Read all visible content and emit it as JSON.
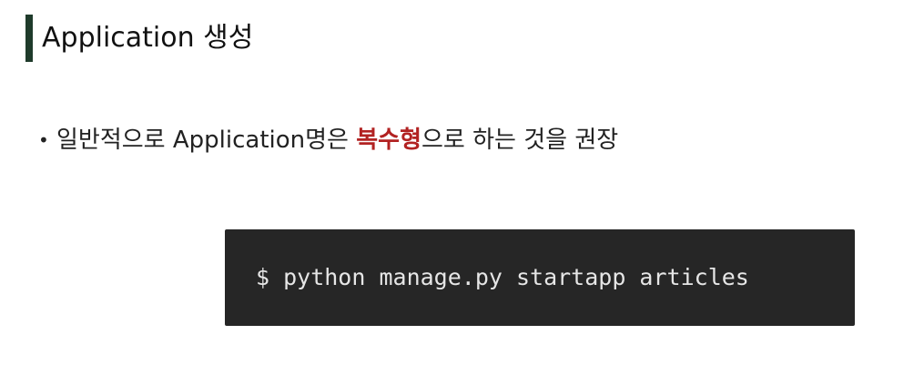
{
  "title": "Application 생성",
  "bullet": {
    "marker": "•",
    "before": "일반적으로 Application명은 ",
    "emphasis": "복수형",
    "after": "으로 하는 것을 권장"
  },
  "code": {
    "command": "$ python manage.py startapp articles"
  },
  "colors": {
    "title_bar": "#1f3b2b",
    "emphasis": "#b22222",
    "code_background": "#262626",
    "code_text": "#e6e6e6"
  }
}
